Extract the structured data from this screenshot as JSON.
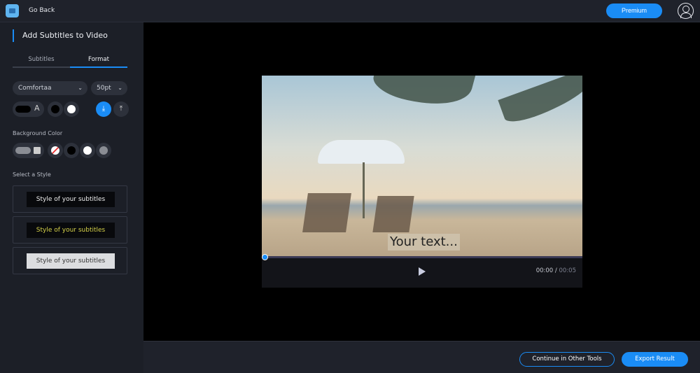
{
  "topbar": {
    "back_label": "Go Back",
    "premium_label": "Premium"
  },
  "sidebar": {
    "title": "Add Subtitles to Video",
    "tabs": [
      {
        "label": "Subtitles"
      },
      {
        "label": "Format"
      }
    ],
    "font": "Comfortaa",
    "size": "50pt",
    "text_icon_letter": "A",
    "background_label": "Background Color",
    "style_label": "Select a Style",
    "styles": [
      {
        "label": "Style of your subtitles"
      },
      {
        "label": "Style of your subtitles"
      },
      {
        "label": "Style of your subtitles"
      }
    ]
  },
  "player": {
    "caption": "Your text...",
    "current_time": "00:00",
    "separator": " / ",
    "duration": "00:05",
    "progress": 0
  },
  "footer": {
    "continue_label": "Continue in Other Tools",
    "export_label": "Export Result"
  },
  "colors": {
    "accent": "#1a8cf5",
    "style2_text": "#d6d24a"
  }
}
